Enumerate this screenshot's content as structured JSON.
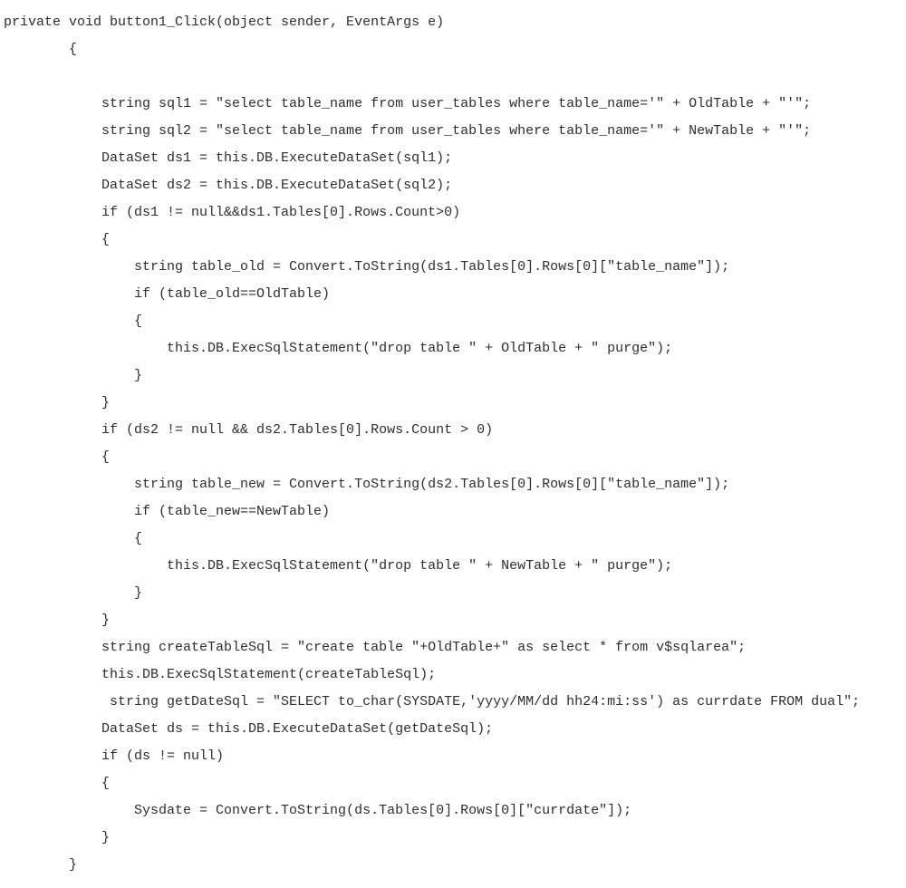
{
  "code": {
    "lines": [
      "private void button1_Click(object sender, EventArgs e)",
      "        {",
      "",
      "            string sql1 = \"select table_name from user_tables where table_name='\" + OldTable + \"'\";",
      "            string sql2 = \"select table_name from user_tables where table_name='\" + NewTable + \"'\";",
      "            DataSet ds1 = this.DB.ExecuteDataSet(sql1);",
      "            DataSet ds2 = this.DB.ExecuteDataSet(sql2);",
      "            if (ds1 != null&&ds1.Tables[0].Rows.Count>0)",
      "            {",
      "                string table_old = Convert.ToString(ds1.Tables[0].Rows[0][\"table_name\"]);",
      "                if (table_old==OldTable)",
      "                {",
      "                    this.DB.ExecSqlStatement(\"drop table \" + OldTable + \" purge\");",
      "                }",
      "            }",
      "            if (ds2 != null && ds2.Tables[0].Rows.Count > 0)",
      "            {",
      "                string table_new = Convert.ToString(ds2.Tables[0].Rows[0][\"table_name\"]);",
      "                if (table_new==NewTable)",
      "                {",
      "                    this.DB.ExecSqlStatement(\"drop table \" + NewTable + \" purge\");",
      "                }",
      "            }",
      "            string createTableSql = \"create table \"+OldTable+\" as select * from v$sqlarea\";",
      "            this.DB.ExecSqlStatement(createTableSql);",
      "             string getDateSql = \"SELECT to_char(SYSDATE,'yyyy/MM/dd hh24:mi:ss') as currdate FROM dual\";",
      "            DataSet ds = this.DB.ExecuteDataSet(getDateSql);",
      "            if (ds != null)",
      "            {",
      "                Sysdate = Convert.ToString(ds.Tables[0].Rows[0][\"currdate\"]);",
      "            }",
      "        }"
    ]
  }
}
